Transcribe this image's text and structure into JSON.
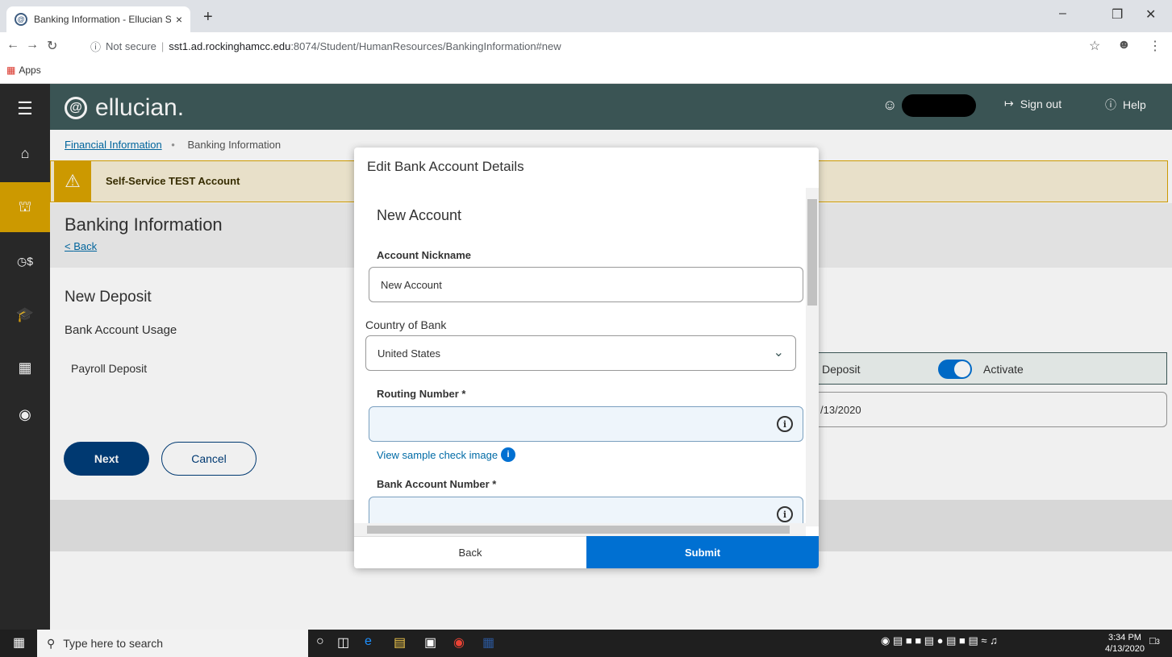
{
  "browser": {
    "tab_title": "Banking Information - Ellucian St",
    "tab_close": "×",
    "new_tab": "+",
    "security": "Not secure",
    "url_host": "sst1.ad.rockinghamcc.edu",
    "url_path": ":8074/Student/HumanResources/BankingInformation#new",
    "bookmarks_apps": "Apps"
  },
  "header": {
    "brand": "ellucian.",
    "sign_out": "Sign out",
    "help": "Help"
  },
  "breadcrumb": {
    "parent": "Financial Information",
    "current": "Banking Information"
  },
  "warning": {
    "text": "Self-Service TEST Account"
  },
  "page": {
    "title": "Banking Information",
    "back": "Back",
    "section": "New Deposit",
    "usage_label": "Bank Account Usage",
    "payroll_label": "Payroll Deposit",
    "deposit_col": "Deposit",
    "activate_label": "Activate",
    "date_value": "/13/2020",
    "next": "Next",
    "cancel": "Cancel"
  },
  "modal": {
    "title": "Edit Bank Account Details",
    "subtitle": "New Account",
    "nickname_label": "Account Nickname",
    "nickname_value": "New Account",
    "country_label": "Country of Bank",
    "country_value": "United States",
    "routing_label": "Routing Number *",
    "routing_value": "",
    "sample_link": "View sample check image",
    "account_label": "Bank Account Number *",
    "account_value": "",
    "back": "Back",
    "submit": "Submit"
  },
  "taskbar": {
    "search_placeholder": "Type here to search",
    "time": "3:34 PM",
    "date": "4/13/2020",
    "notifications": "3"
  },
  "colors": {
    "header": "#3e5a5a",
    "sidebar": "#2b2b2b",
    "accent": "#d9a300",
    "primary": "#0070d2",
    "navy": "#003d79"
  }
}
